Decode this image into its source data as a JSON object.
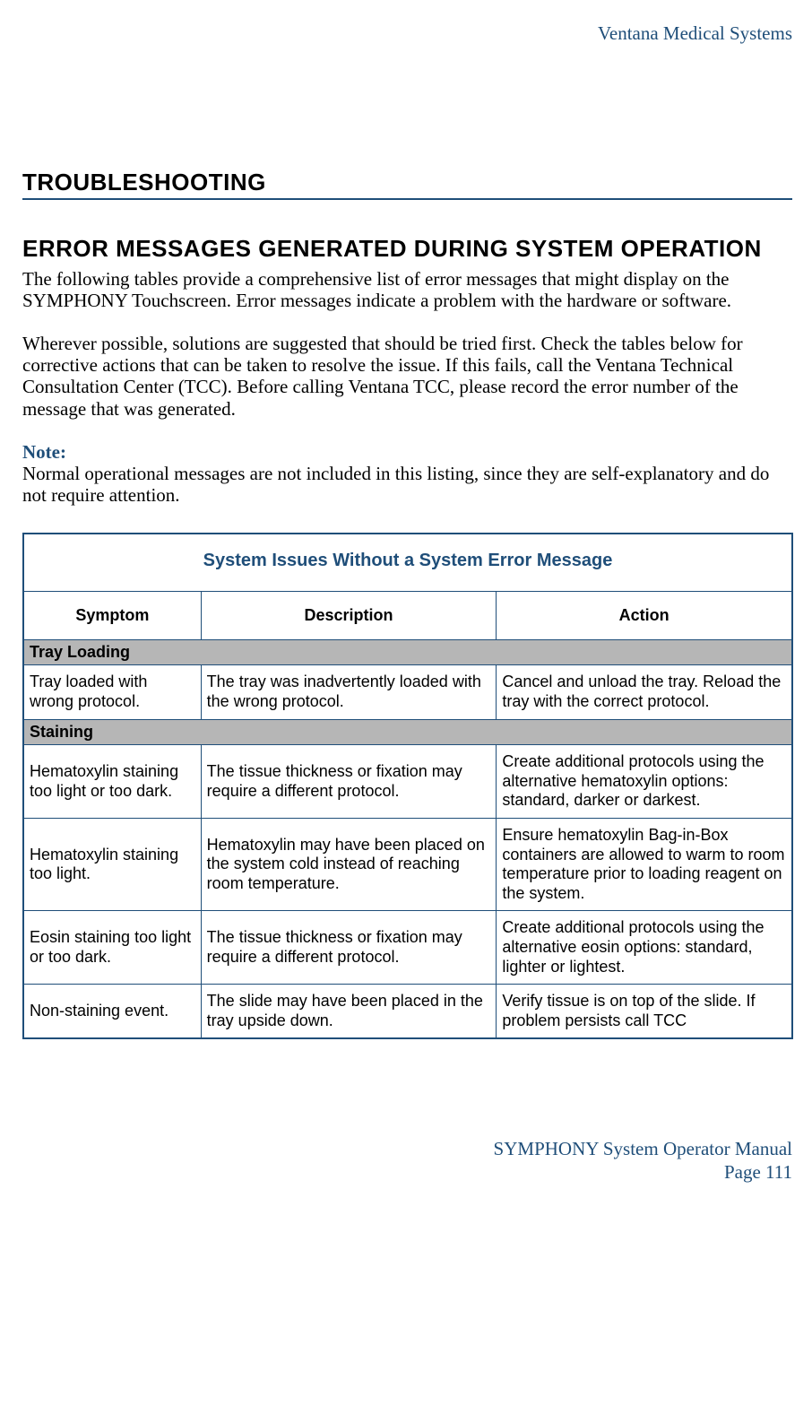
{
  "header": {
    "company": "Ventana Medical Systems"
  },
  "titles": {
    "main": "TROUBLESHOOTING",
    "sub": "ERROR MESSAGES GENERATED DURING SYSTEM OPERATION"
  },
  "paras": {
    "p1": "The following tables provide a comprehensive list of error messages that might display on the SYMPHONY Touchscreen. Error messages indicate a problem with the hardware or software.",
    "p2": "Wherever possible, solutions are suggested that should be tried first.  Check the tables below for corrective actions that can be taken to resolve the issue. If this fails, call the Ventana Technical Consultation Center (TCC). Before calling Ventana TCC, please record the error number of the message that was generated.",
    "note_label": "Note:",
    "note_body": "Normal operational messages are not included in this listing, since they are self-explanatory and do not require attention."
  },
  "table": {
    "title": "System Issues Without a System Error Message",
    "cols": {
      "symptom": "Symptom",
      "description": "Description",
      "action": "Action"
    },
    "sections": {
      "tray": "Tray Loading",
      "staining": "Staining"
    },
    "rows": {
      "r1": {
        "sym": "Tray loaded with wrong protocol.",
        "desc": "The tray was inadvertently loaded with the wrong protocol.",
        "act": "Cancel and unload the tray. Reload the tray with the correct protocol."
      },
      "r2": {
        "sym": "Hematoxylin staining too light or too dark.",
        "desc": "The tissue thickness or fixation may require a different protocol.",
        "act": "Create additional protocols using the alternative hematoxylin options:  standard, darker or darkest."
      },
      "r3": {
        "sym": "Hematoxylin staining too light.",
        "desc": "Hematoxylin may have been placed on the system cold instead of reaching room temperature.",
        "act": "Ensure hematoxylin Bag-in-Box containers are allowed to warm to room temperature prior to loading reagent on the system."
      },
      "r4": {
        "sym": "Eosin staining too light or too dark.",
        "desc": "The tissue thickness or fixation may require a different protocol.",
        "act": "Create additional protocols using the alternative eosin options: standard, lighter or lightest."
      },
      "r5": {
        "sym": "Non-staining event.",
        "desc": "The slide may have been placed in the tray upside down.",
        "act": "Verify tissue is on top of the slide. If problem persists call TCC"
      }
    }
  },
  "footer": {
    "line1": "SYMPHONY System Operator Manual",
    "line2": "Page 111"
  }
}
